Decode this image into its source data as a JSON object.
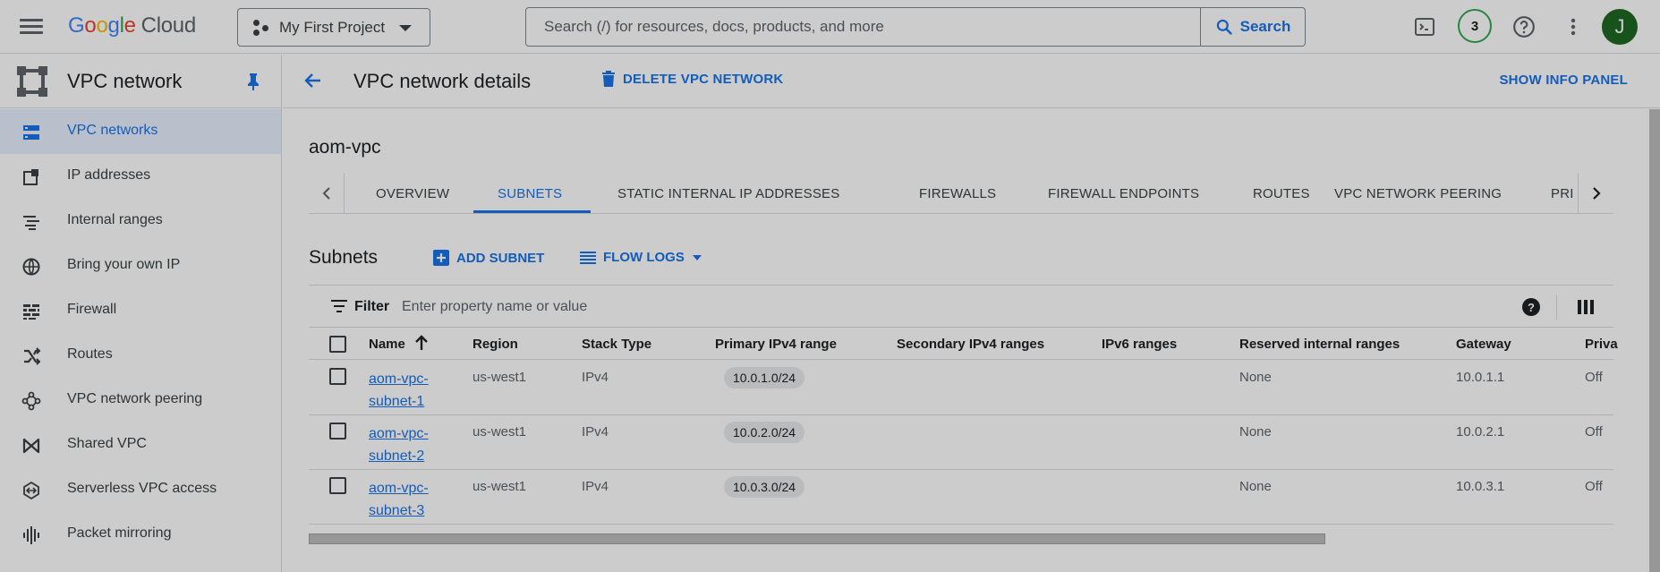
{
  "topbar": {
    "logo": {
      "g1": "G",
      "g2": "o",
      "g3": "o",
      "g4": "g",
      "g5": "l",
      "g6": "e",
      "cloud": "Cloud"
    },
    "project": "My First Project",
    "search_placeholder": "Search (/) for resources, docs, products, and more",
    "search_button": "Search",
    "notifications_count": "3",
    "avatar_initial": "J"
  },
  "sidebar": {
    "title": "VPC network",
    "items": [
      {
        "label": "VPC networks",
        "icon": "vpc-networks-icon",
        "active": true
      },
      {
        "label": "IP addresses",
        "icon": "ip-addresses-icon"
      },
      {
        "label": "Internal ranges",
        "icon": "internal-ranges-icon"
      },
      {
        "label": "Bring your own IP",
        "icon": "globe-icon"
      },
      {
        "label": "Firewall",
        "icon": "firewall-icon"
      },
      {
        "label": "Routes",
        "icon": "routes-icon"
      },
      {
        "label": "VPC network peering",
        "icon": "peering-icon"
      },
      {
        "label": "Shared VPC",
        "icon": "shared-vpc-icon"
      },
      {
        "label": "Serverless VPC access",
        "icon": "serverless-icon"
      },
      {
        "label": "Packet mirroring",
        "icon": "packet-mirroring-icon"
      }
    ]
  },
  "header": {
    "title": "VPC network details",
    "delete_label": "DELETE VPC NETWORK",
    "info_panel_label": "SHOW INFO PANEL"
  },
  "network_name": "aom-vpc",
  "tabs": [
    "OVERVIEW",
    "SUBNETS",
    "STATIC INTERNAL IP ADDRESSES",
    "FIREWALLS",
    "FIREWALL ENDPOINTS",
    "ROUTES",
    "VPC NETWORK PEERING",
    "PRI"
  ],
  "active_tab": "SUBNETS",
  "subnets": {
    "title": "Subnets",
    "add_label": "ADD SUBNET",
    "flow_logs_label": "FLOW LOGS",
    "filter_label": "Filter",
    "filter_placeholder": "Enter property name or value",
    "columns": [
      "Name",
      "Region",
      "Stack Type",
      "Primary IPv4 range",
      "Secondary IPv4 ranges",
      "IPv6 ranges",
      "Reserved internal ranges",
      "Gateway",
      "Priva"
    ],
    "rows": [
      {
        "name": "aom-vpc-subnet-1",
        "region": "us-west1",
        "stack": "IPv4",
        "primary": "10.0.1.0/24",
        "secondary": "",
        "ipv6": "",
        "reserved": "None",
        "gateway": "10.0.1.1",
        "private": "Off"
      },
      {
        "name": "aom-vpc-subnet-2",
        "region": "us-west1",
        "stack": "IPv4",
        "primary": "10.0.2.0/24",
        "secondary": "",
        "ipv6": "",
        "reserved": "None",
        "gateway": "10.0.2.1",
        "private": "Off"
      },
      {
        "name": "aom-vpc-subnet-3",
        "region": "us-west1",
        "stack": "IPv4",
        "primary": "10.0.3.0/24",
        "secondary": "",
        "ipv6": "",
        "reserved": "None",
        "gateway": "10.0.3.1",
        "private": "Off"
      }
    ]
  },
  "colors": {
    "accent": "#1a73e8",
    "active_nav_bg": "#e8f0fe",
    "notif_ring": "#34a853",
    "avatar_bg": "#1e6823"
  }
}
